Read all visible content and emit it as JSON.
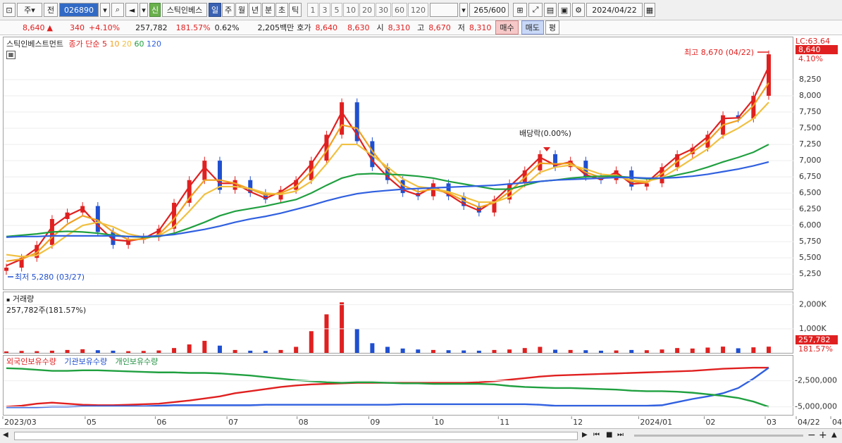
{
  "toolbar": {
    "type_label": "주",
    "cmp_label": "전",
    "stock_code": "026890",
    "badge": "신",
    "stock_name": "스틱인베스",
    "periods": [
      "일",
      "주",
      "월",
      "년",
      "분",
      "초",
      "틱"
    ],
    "active_period": "일",
    "minutes": [
      "1",
      "3",
      "5",
      "10",
      "20",
      "30",
      "60",
      "120"
    ],
    "count": "265",
    "count_total": "/600",
    "date": "2024/04/22"
  },
  "quote": {
    "price": "8,640",
    "change": "340",
    "change_pct": "+4.10%",
    "volume": "257,782",
    "volume_ratio": "181.57%",
    "turnover": "0.62%",
    "amount": "2,205백만",
    "hoga_label": "호가",
    "ask": "8,640",
    "bid": "8,630",
    "open_label": "시",
    "open": "8,310",
    "high_label": "고",
    "high": "8,670",
    "low_label": "저",
    "low": "8,310",
    "buy_label": "매수",
    "sell_label": "매도",
    "eval_label": "평"
  },
  "colors": {
    "up": "#e02020",
    "down": "#1f4fd0",
    "ma5": "#e02020",
    "ma10": "#f0a020",
    "ma20": "#f0c040",
    "ma60": "#20a040",
    "ma120": "#3060e0",
    "foreign": "#e02020",
    "institution": "#3060e0",
    "individual": "#20a040"
  },
  "price_pane": {
    "legend_name": "스틱인베스트먼트",
    "legend_ma_title": "종가 단순",
    "ma_periods": [
      "5",
      "10",
      "20",
      "60",
      "120"
    ],
    "lc_label": "LC:63.64",
    "last_price": "8,640",
    "last_pct": "4.10%",
    "high_note": "최고 8,670 (04/22)",
    "low_note": "최저 5,280 (03/27)",
    "dividend_note": "배당락(0.00%)"
  },
  "volume_pane": {
    "title": "거래량",
    "subtitle": "257,782주(181.57%)",
    "last_volume": "257,782",
    "last_ratio": "181.57%"
  },
  "holdings_pane": {
    "series_names": [
      "외국인보유수량",
      "기관보유수량",
      "개인보유수량"
    ]
  },
  "chart_data": [
    {
      "type": "line",
      "title": "스틱인베스트먼트",
      "ylim": [
        5100,
        8750
      ],
      "y_ticks": [
        5250,
        5500,
        5750,
        6000,
        6250,
        6500,
        6750,
        7000,
        7250,
        7500,
        7750,
        8000,
        8250
      ],
      "x_ticks": [
        "2023/03",
        "05",
        "06",
        "07",
        "08",
        "09",
        "10",
        "11",
        "12",
        "2024/01",
        "02",
        "03",
        "04",
        "04/22"
      ],
      "series": [
        {
          "name": "종가",
          "values": [
            5350,
            5500,
            5700,
            6100,
            6200,
            6300,
            5900,
            5700,
            5780,
            5820,
            5950,
            6350,
            6700,
            7000,
            6550,
            6700,
            6500,
            6400,
            6550,
            6700,
            7000,
            7400,
            7900,
            7300,
            6900,
            6700,
            6500,
            6450,
            6650,
            6450,
            6300,
            6200,
            6400,
            6650,
            6850,
            7100,
            6900,
            7000,
            6750,
            6700,
            6850,
            6600,
            6650,
            6900,
            7100,
            7200,
            7400,
            7700,
            7650,
            8000,
            8640
          ]
        },
        {
          "name": "5",
          "values": [
            5380,
            5480,
            5650,
            5980,
            6150,
            6260,
            6000,
            5780,
            5760,
            5800,
            5920,
            6250,
            6600,
            6900,
            6650,
            6650,
            6520,
            6420,
            6520,
            6680,
            6950,
            7300,
            7750,
            7400,
            7000,
            6750,
            6550,
            6470,
            6600,
            6480,
            6330,
            6230,
            6380,
            6600,
            6820,
            7050,
            6930,
            6980,
            6780,
            6710,
            6820,
            6640,
            6660,
            6870,
            7070,
            7180,
            7370,
            7650,
            7660,
            7950,
            8450
          ]
        },
        {
          "name": "10",
          "values": [
            5450,
            5480,
            5580,
            5820,
            6020,
            6150,
            6080,
            5900,
            5780,
            5790,
            5860,
            6100,
            6420,
            6700,
            6700,
            6650,
            6560,
            6470,
            6500,
            6600,
            6830,
            7150,
            7550,
            7500,
            7150,
            6850,
            6620,
            6520,
            6560,
            6500,
            6380,
            6280,
            6350,
            6520,
            6740,
            6960,
            6950,
            6960,
            6820,
            6740,
            6780,
            6680,
            6660,
            6800,
            6990,
            7130,
            7300,
            7550,
            7620,
            7850,
            8200
          ]
        },
        {
          "name": "20",
          "values": [
            5550,
            5520,
            5540,
            5680,
            5850,
            6000,
            6050,
            5980,
            5870,
            5820,
            5840,
            5980,
            6220,
            6480,
            6600,
            6600,
            6570,
            6500,
            6480,
            6530,
            6680,
            6950,
            7250,
            7250,
            7080,
            6900,
            6720,
            6600,
            6570,
            6520,
            6440,
            6360,
            6360,
            6440,
            6620,
            6820,
            6900,
            6930,
            6870,
            6790,
            6770,
            6700,
            6680,
            6740,
            6880,
            7030,
            7180,
            7380,
            7500,
            7650,
            7900
          ]
        },
        {
          "name": "60",
          "values": [
            5830,
            5850,
            5870,
            5900,
            5910,
            5900,
            5880,
            5850,
            5830,
            5820,
            5830,
            5880,
            5960,
            6050,
            6150,
            6220,
            6260,
            6300,
            6350,
            6400,
            6500,
            6620,
            6730,
            6790,
            6800,
            6790,
            6780,
            6760,
            6730,
            6680,
            6640,
            6600,
            6560,
            6560,
            6620,
            6680,
            6700,
            6730,
            6750,
            6760,
            6760,
            6740,
            6720,
            6730,
            6780,
            6830,
            6900,
            6980,
            7050,
            7130,
            7250
          ]
        },
        {
          "name": "120",
          "values": [
            5820,
            5830,
            5830,
            5840,
            5840,
            5840,
            5840,
            5840,
            5830,
            5830,
            5840,
            5860,
            5900,
            5940,
            5990,
            6050,
            6100,
            6140,
            6190,
            6250,
            6310,
            6380,
            6440,
            6490,
            6520,
            6540,
            6560,
            6570,
            6580,
            6590,
            6600,
            6610,
            6620,
            6640,
            6660,
            6680,
            6700,
            6710,
            6720,
            6730,
            6740,
            6740,
            6730,
            6730,
            6740,
            6760,
            6790,
            6830,
            6870,
            6920,
            6980
          ]
        }
      ]
    },
    {
      "type": "bar",
      "title": "거래량",
      "ylim": [
        0,
        2400000
      ],
      "y_ticks": [
        "2,000K",
        "1,000K"
      ],
      "values": [
        60000,
        80000,
        70000,
        90000,
        120000,
        150000,
        110000,
        90000,
        70000,
        80000,
        100000,
        200000,
        350000,
        500000,
        300000,
        120000,
        90000,
        80000,
        120000,
        250000,
        900000,
        1600000,
        2100000,
        1000000,
        400000,
        250000,
        180000,
        140000,
        120000,
        110000,
        100000,
        90000,
        120000,
        140000,
        200000,
        250000,
        130000,
        120000,
        110000,
        90000,
        100000,
        120000,
        110000,
        140000,
        200000,
        180000,
        220000,
        260000,
        190000,
        230000,
        257782
      ]
    },
    {
      "type": "line",
      "title": "보유수량",
      "ylim": [
        -5500000,
        -500000
      ],
      "y_ticks": [
        "-2,500,000",
        "-5,000,000"
      ],
      "series": [
        {
          "name": "외국인보유수량",
          "values": [
            -5000000,
            -4900000,
            -4700000,
            -4600000,
            -4700000,
            -4800000,
            -4850000,
            -4850000,
            -4800000,
            -4750000,
            -4700000,
            -4550000,
            -4400000,
            -4200000,
            -4000000,
            -3700000,
            -3500000,
            -3300000,
            -3100000,
            -2950000,
            -2850000,
            -2800000,
            -2750000,
            -2700000,
            -2700000,
            -2700000,
            -2700000,
            -2700000,
            -2700000,
            -2700000,
            -2700000,
            -2650000,
            -2550000,
            -2400000,
            -2250000,
            -2100000,
            -2000000,
            -1950000,
            -1900000,
            -1850000,
            -1800000,
            -1750000,
            -1700000,
            -1650000,
            -1600000,
            -1550000,
            -1450000,
            -1350000,
            -1300000,
            -1250000,
            -1250000
          ]
        },
        {
          "name": "기관보유수량",
          "values": [
            -5050000,
            -5050000,
            -5050000,
            -5000000,
            -5000000,
            -4950000,
            -4950000,
            -4950000,
            -4950000,
            -4950000,
            -4900000,
            -4850000,
            -4850000,
            -4850000,
            -4850000,
            -4850000,
            -4850000,
            -4800000,
            -4800000,
            -4800000,
            -4800000,
            -4800000,
            -4800000,
            -4800000,
            -4800000,
            -4800000,
            -4750000,
            -4750000,
            -4750000,
            -4750000,
            -4750000,
            -4750000,
            -4750000,
            -4750000,
            -4750000,
            -4800000,
            -4900000,
            -4900000,
            -4900000,
            -4900000,
            -4900000,
            -4900000,
            -4900000,
            -4850000,
            -4550000,
            -4250000,
            -4000000,
            -3700000,
            -3200000,
            -2300000,
            -1250000
          ]
        },
        {
          "name": "개인보유수량",
          "values": [
            -1300000,
            -1350000,
            -1450000,
            -1550000,
            -1550000,
            -1500000,
            -1500000,
            -1550000,
            -1600000,
            -1650000,
            -1700000,
            -1700000,
            -1750000,
            -1750000,
            -1800000,
            -1900000,
            -2000000,
            -2150000,
            -2300000,
            -2450000,
            -2550000,
            -2650000,
            -2700000,
            -2650000,
            -2650000,
            -2700000,
            -2750000,
            -2750000,
            -2800000,
            -2800000,
            -2800000,
            -2800000,
            -2850000,
            -3000000,
            -3100000,
            -3150000,
            -3200000,
            -3200000,
            -3250000,
            -3300000,
            -3350000,
            -3450000,
            -3500000,
            -3500000,
            -3550000,
            -3650000,
            -3800000,
            -3950000,
            -4150000,
            -4500000,
            -5000000
          ]
        }
      ]
    }
  ]
}
